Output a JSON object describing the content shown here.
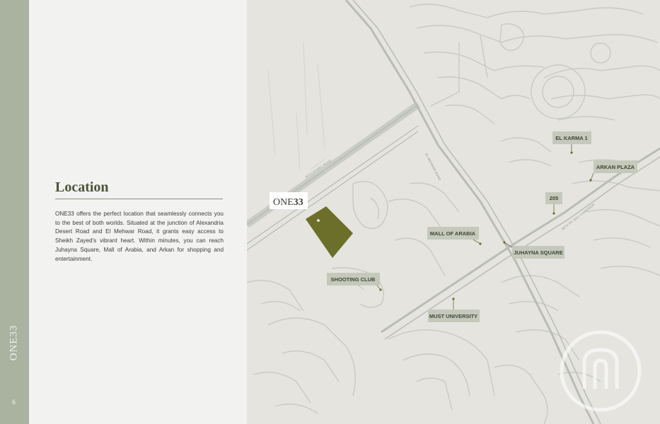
{
  "sidebar": {
    "brand": "ONE33",
    "page_number": "6"
  },
  "section": {
    "title": "Location",
    "body": "ONE33 offers the perfect location that seamlessly connects you to the best of both worlds. Situated at the junction of Alexandria Desert Road and El Mehwar Road, it grants easy access to Sheikh Zayed's vibrant heart. Within minutes, you can reach Juhayna Square, Mall of Arabia, and Arkan for shopping and entertainment."
  },
  "map": {
    "project_marker": {
      "prefix": "ONE",
      "suffix": "33"
    },
    "places": [
      "EL KARMA 1",
      "ARKAN PLAZA",
      "205",
      "MALL OF ARABIA",
      "JUHAYNA SQUARE",
      "SHOOTING CLUB",
      "MUST UNIVERSITY"
    ],
    "roads": [
      "BOULEVARD ROAD",
      "EL MEHWAR ROAD",
      "26TH OF JULY CORRIDOR"
    ],
    "colors": {
      "plot": "#6b6f2a",
      "background": "#e5e4df",
      "road": "#b9bdb4",
      "sidebar": "#a9b3a0"
    }
  }
}
